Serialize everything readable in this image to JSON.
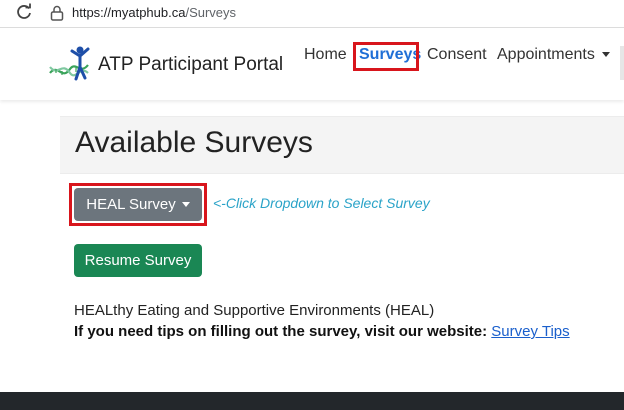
{
  "browser": {
    "url_prefix": "https://",
    "url_domain": "myatphub.ca",
    "url_path": "/Surveys"
  },
  "navbar": {
    "brand": "ATP Participant Portal",
    "links": {
      "home": "Home",
      "surveys": "Surveys",
      "consent": "Consent",
      "appointments": "Appointments"
    },
    "active_color": "#1f6fd6"
  },
  "page": {
    "title": "Available Surveys",
    "dropdown_label": "HEAL Survey",
    "annotation": "<-Click Dropdown to Select Survey",
    "resume_label": "Resume Survey",
    "survey_description": "HEALthy Eating and Supportive Environments (HEAL)",
    "tips_text": "If you need tips on filling out the survey, visit our website:",
    "tips_link": "Survey Tips"
  },
  "colors": {
    "highlight": "#d8151c",
    "dropdown_bg": "#6c757d",
    "resume_bg": "#1a8754",
    "annotation": "#2aa3c8",
    "link": "#1a5fcc",
    "footer": "#23272b"
  },
  "icons": {
    "reload": "reload-icon",
    "lock": "lock-icon",
    "logo": "atp-logo-icon",
    "dropdown_caret": "caret-down-icon"
  }
}
